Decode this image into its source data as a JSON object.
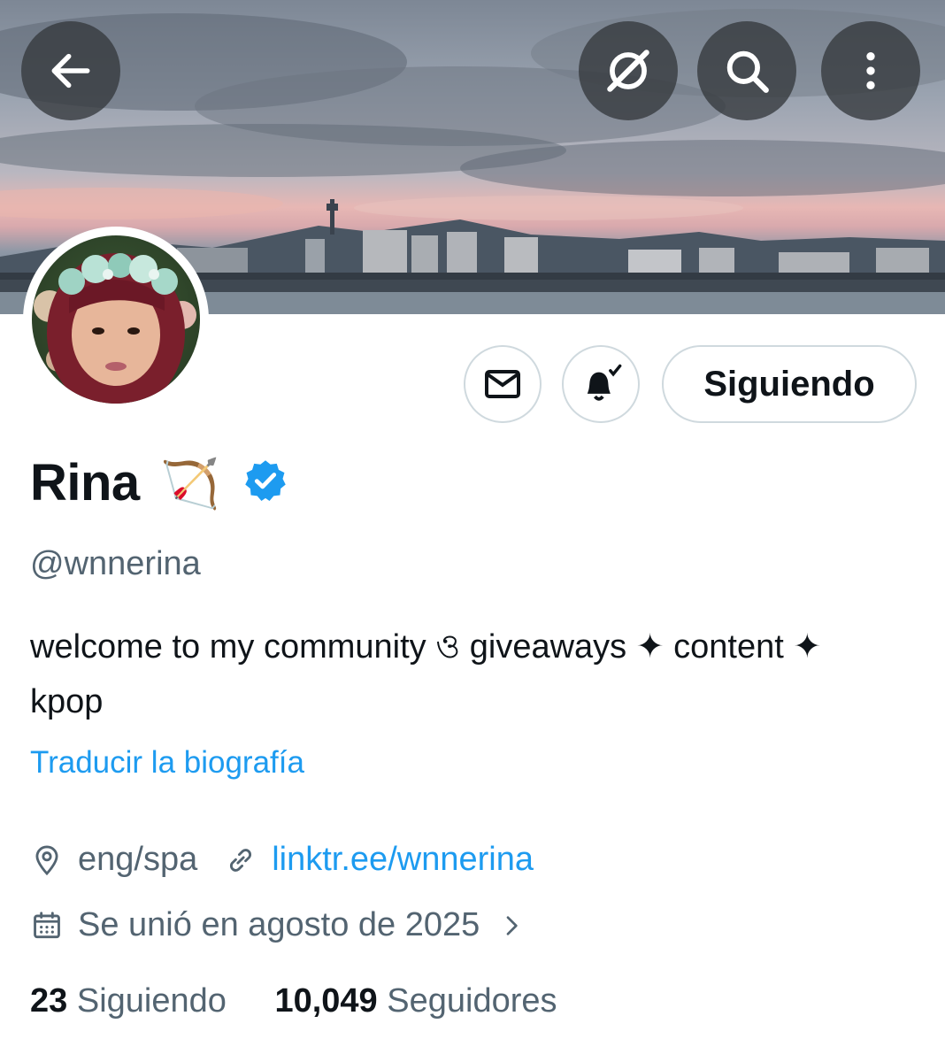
{
  "header": {
    "back_icon": "arrow-left-icon",
    "grok_icon": "grok-icon",
    "search_icon": "search-icon",
    "more_icon": "more-vertical-icon"
  },
  "actions": {
    "message_icon": "envelope-icon",
    "notify_icon": "bell-check-icon",
    "follow_label": "Siguiendo"
  },
  "profile": {
    "name": "Rina",
    "name_emoji": "🏹",
    "verified_icon": "verified-badge-icon",
    "verified_color": "#1d9bf0",
    "handle": "@wnnerina",
    "bio_line1": "welcome to my community ও giveaways ✦ content ✦",
    "bio_line2": "kpop",
    "translate_label": "Traducir la biografía",
    "location": "eng/spa",
    "link": "linktr.ee/wnnerina",
    "joined": "Se unió en agosto de 2025"
  },
  "stats": {
    "following_count": "23",
    "following_label": "Siguiendo",
    "followers_count": "10,049",
    "followers_label": "Seguidores"
  },
  "colors": {
    "accent": "#1d9bf0",
    "secondary_text": "#536471",
    "primary_text": "#0f1419",
    "border": "#cfd9de"
  }
}
